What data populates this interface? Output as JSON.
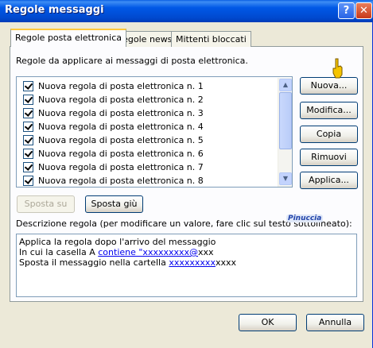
{
  "window": {
    "title": "Regole messaggi",
    "help_glyph": "?",
    "close_glyph": "✕"
  },
  "tabs": [
    {
      "label": "Regole posta elettronica",
      "active": true
    },
    {
      "label": "Regole news",
      "active": false
    },
    {
      "label": "Mittenti bloccati",
      "active": false
    }
  ],
  "intro_text": "Regole da applicare ai messaggi di posta elettronica.",
  "rules": [
    {
      "label": "Nuova regola di posta elettronica n. 1",
      "checked": true
    },
    {
      "label": "Nuova regola di posta elettronica n. 2",
      "checked": true
    },
    {
      "label": "Nuova regola di posta elettronica n. 3",
      "checked": true
    },
    {
      "label": "Nuova regola di posta elettronica n. 4",
      "checked": true
    },
    {
      "label": "Nuova regola di posta elettronica n. 5",
      "checked": true
    },
    {
      "label": "Nuova regola di posta elettronica n. 6",
      "checked": true
    },
    {
      "label": "Nuova regola di posta elettronica n. 7",
      "checked": true
    },
    {
      "label": "Nuova regola di posta elettronica n. 8",
      "checked": true
    }
  ],
  "side_buttons": {
    "new": "Nuova...",
    "edit": "Modifica...",
    "copy": "Copia",
    "remove": "Rimuovi",
    "apply": "Applica..."
  },
  "move_buttons": {
    "up": "Sposta su",
    "down": "Sposta giù"
  },
  "description_label": "Descrizione regola (per modificare un valore, fare clic sul testo sottolineato):",
  "description": {
    "line1": "Applica la regola dopo l'arrivo del messaggio",
    "line2_prefix": "In cui la casella A ",
    "line2_link": "contiene \"xxxxxxxxx@",
    "line2_suffix": "xxx",
    "line3_prefix": "Sposta il messaggio nella cartella ",
    "line3_link": "xxxxxxxxx",
    "line3_suffix": "xxxx"
  },
  "watermark": "Pinuccia",
  "dialog_buttons": {
    "ok": "OK",
    "cancel": "Annulla"
  },
  "scrollbar_icons": {
    "up": "up-arrow-icon",
    "down": "down-arrow-icon"
  }
}
